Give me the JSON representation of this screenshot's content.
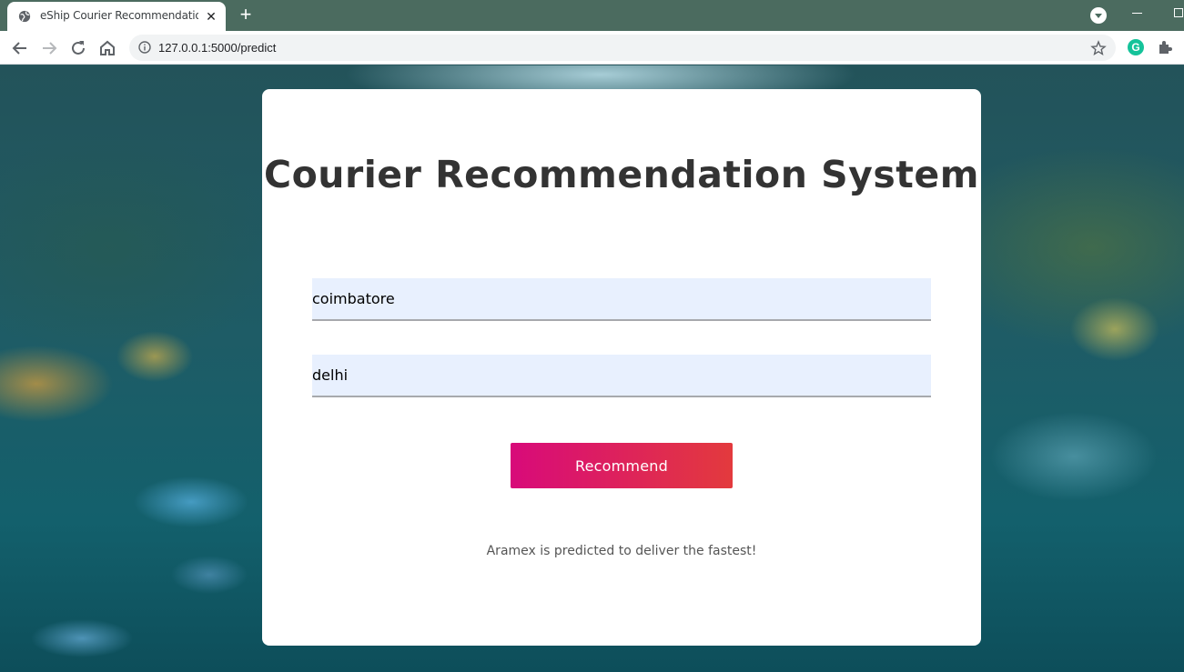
{
  "browser": {
    "tab_title": "eShip Courier Recommendation S",
    "url": "127.0.0.1:5000/predict",
    "icons": {
      "favicon": "globe-icon",
      "close": "close-icon",
      "new_tab": "plus-icon",
      "back": "back-arrow-icon",
      "forward": "forward-arrow-icon",
      "reload": "reload-icon",
      "home": "home-icon",
      "info": "info-icon",
      "bookmark": "star-icon",
      "grammarly": "grammarly-icon",
      "extensions": "puzzle-icon",
      "tab_search": "chevron-down-icon"
    },
    "grammarly_letter": "G"
  },
  "page": {
    "title": "Courier Recommendation System",
    "source_city": "coimbatore",
    "destination_city": "delhi",
    "button_label": "Recommend",
    "result": "Aramex is predicted to deliver the fastest!",
    "button_gradient": [
      "#d80a7a",
      "#e33a3d"
    ],
    "field_background": "#e8f0fe"
  }
}
